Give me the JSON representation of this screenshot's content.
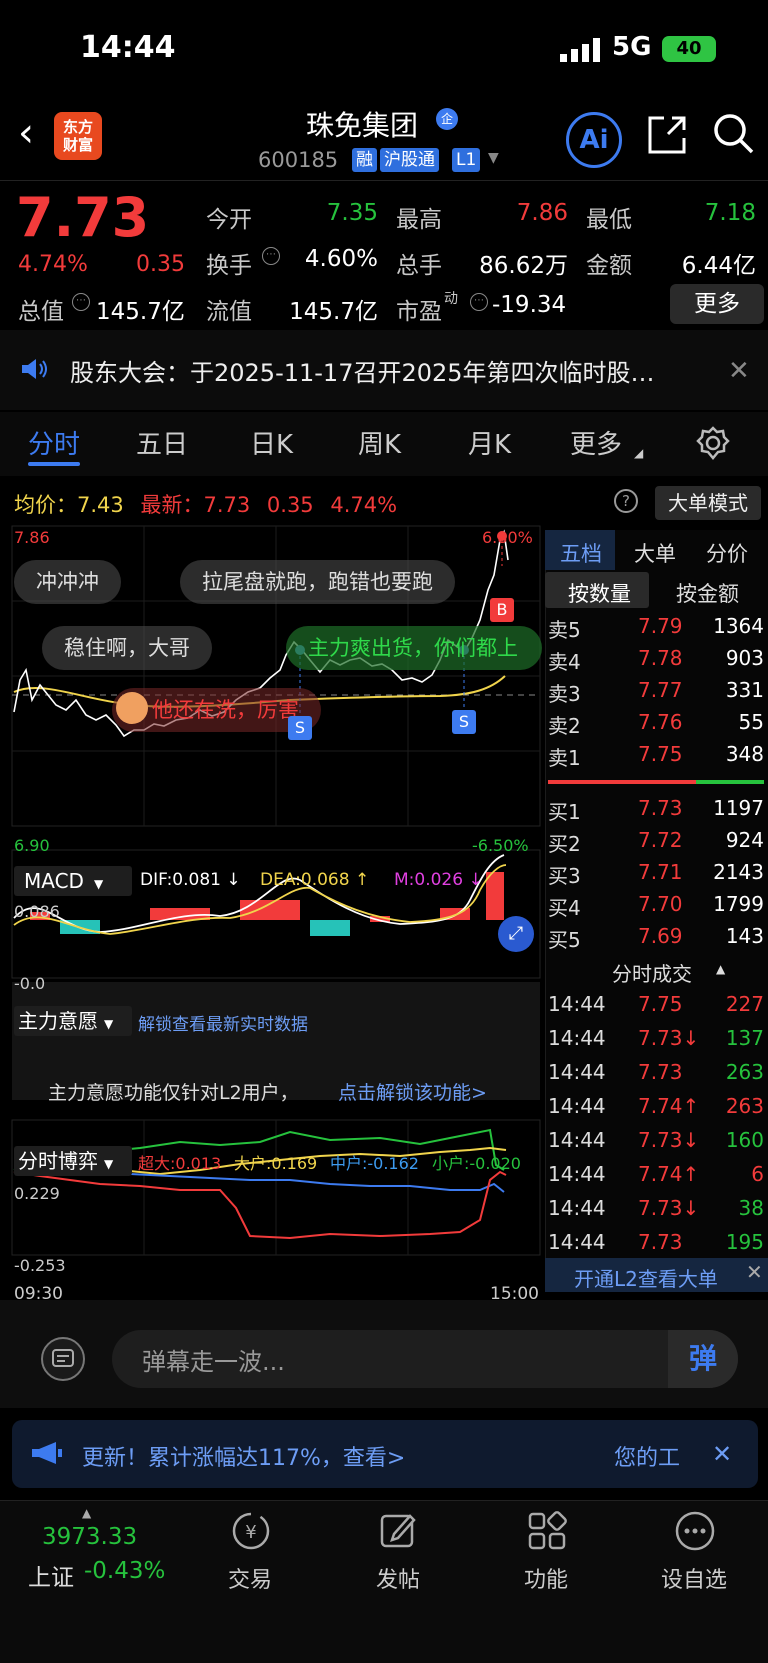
{
  "status": {
    "time": "14:44",
    "network": "5G",
    "battery": "40"
  },
  "header": {
    "stock_name": "珠免集团",
    "qi_badge": "企",
    "stock_code": "600185",
    "tags": [
      "融",
      "沪股通",
      "L1"
    ],
    "ai_label": "Ai",
    "logo": [
      "东方",
      "财富"
    ]
  },
  "quote": {
    "price": "7.73",
    "change_pct": "4.74%",
    "change": "0.35",
    "open_label": "今开",
    "open": "7.35",
    "high_label": "最高",
    "high": "7.86",
    "low_label": "最低",
    "low": "7.18",
    "turnover_label": "换手",
    "turnover": "4.60%",
    "volume_label": "总手",
    "volume": "86.62万",
    "amount_label": "金额",
    "amount": "6.44亿",
    "mktcap_label": "总值",
    "mktcap": "145.7亿",
    "float_label": "流值",
    "float": "145.7亿",
    "pe_label": "市盈",
    "pe_sup": "动",
    "pe": "-19.34",
    "more_label": "更多"
  },
  "notice": {
    "text": "股东大会：于2025-11-17召开2025年第四次临时股…"
  },
  "tabs": [
    "分时",
    "五日",
    "日K",
    "周K",
    "月K",
    "更多"
  ],
  "chart": {
    "avg_label": "均价：",
    "avg": "7.43",
    "latest_label": "最新：",
    "latest": "7.73",
    "latest_change": "0.35",
    "latest_pct": "4.74%",
    "bigorder_label": "大单模式",
    "y_max": "7.86",
    "y_min": "6.90",
    "y_max_pct": "6.80%",
    "y_min_pct": "-6.50%",
    "danmu": [
      "冲冲冲",
      "拉尾盘就跑，跑错也要跑",
      "稳住啊，大哥",
      "主力爽出货，你们都上",
      "他还在洗，厉害"
    ],
    "macd_label": "MACD",
    "dif": "DIF:0.081 ↓",
    "dea": "DEA:0.068 ↑",
    "m": "M:0.026 ↓",
    "macd_top": "0.086",
    "macd_bottom": "-0.0",
    "zl_label": "主力意愿",
    "zl_unlock": "解锁查看最新实时数据",
    "zl_msg": "主力意愿功能仅针对L2用户，",
    "zl_link": "点击解锁该功能>",
    "by_label": "分时博弈",
    "by_super": "超大:0.013",
    "by_big": "大户:0.169",
    "by_mid": "中户:-0.162",
    "by_small": "小户:-0.020",
    "by_top": "0.229",
    "by_bottom": "-0.253",
    "t_start": "09:30",
    "t_end": "15:00"
  },
  "chart_data": {
    "type": "line",
    "title": "",
    "series": [
      {
        "name": "",
        "x": [
          "09:30",
          "10:00",
          "10:30",
          "11:00",
          "11:30",
          "13:30",
          "14:00",
          "14:30",
          "14:44"
        ],
        "values": [
          7.42,
          7.35,
          7.22,
          7.3,
          7.4,
          7.66,
          7.5,
          7.55,
          7.73
        ]
      }
    ],
    "ylim": [
      6.9,
      7.86
    ]
  },
  "book": {
    "tabs": [
      "五档",
      "大单",
      "分价"
    ],
    "sub_tabs": [
      "按数量",
      "按金额"
    ],
    "sells": [
      [
        "卖5",
        "7.79",
        "1364"
      ],
      [
        "卖4",
        "7.78",
        "903"
      ],
      [
        "卖3",
        "7.77",
        "331"
      ],
      [
        "卖2",
        "7.76",
        "55"
      ],
      [
        "卖1",
        "7.75",
        "348"
      ]
    ],
    "buys": [
      [
        "买1",
        "7.73",
        "1197"
      ],
      [
        "买2",
        "7.72",
        "924"
      ],
      [
        "买3",
        "7.71",
        "2143"
      ],
      [
        "买4",
        "7.70",
        "1799"
      ],
      [
        "买5",
        "7.69",
        "143"
      ]
    ],
    "ticks_title": "分时成交",
    "ticks": [
      [
        "14:44",
        "7.75",
        "227"
      ],
      [
        "14:44",
        "7.73↓",
        "137"
      ],
      [
        "14:44",
        "7.73",
        "263"
      ],
      [
        "14:44",
        "7.74↑",
        "263"
      ],
      [
        "14:44",
        "7.73↓",
        "160"
      ],
      [
        "14:44",
        "7.74↑",
        "6"
      ],
      [
        "14:44",
        "7.73↓",
        "38"
      ],
      [
        "14:44",
        "7.73",
        "195"
      ]
    ],
    "l2_label": "开通L2查看大单"
  },
  "bottom": {
    "danmu_placeholder": "弹幕走一波...",
    "danmu_btn": "弹",
    "ad": "更新！累计涨幅达117%，查看>",
    "ad_right": "您的工",
    "index_value": "3973.33",
    "index_name": "上证",
    "index_pct": "-0.43%",
    "nav": [
      "交易",
      "发帖",
      "功能",
      "设自选"
    ]
  },
  "colors": {
    "up": "#f23b3b",
    "down": "#26c23d",
    "accent": "#3d7bf0",
    "avg_line": "#f0d44c"
  }
}
